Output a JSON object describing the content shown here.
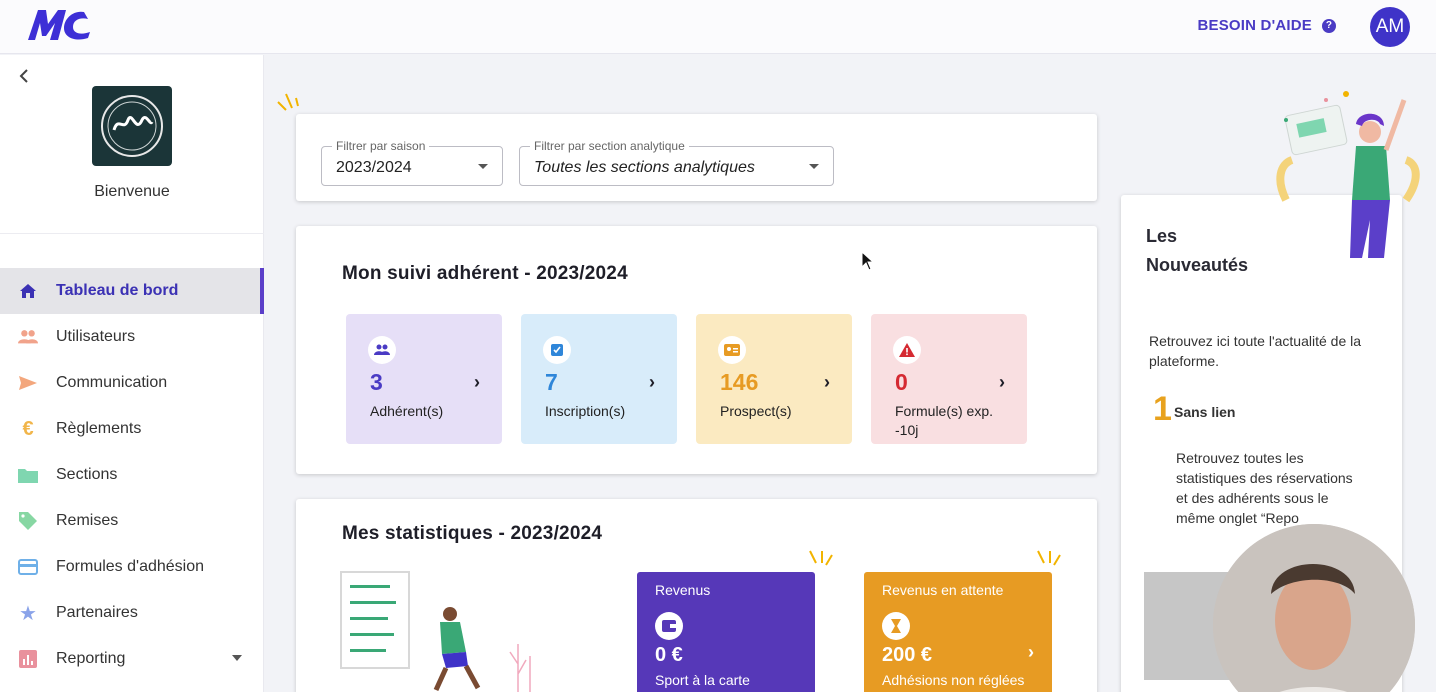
{
  "topbar": {
    "help_label": "BESOIN D'AIDE",
    "help_icon": "question-circle-icon",
    "avatar_initials": "AM",
    "brand_color": "#4a3bc4"
  },
  "sidebar": {
    "back_icon": "chevron-left-icon",
    "welcome": "Bienvenue",
    "items": [
      {
        "label": "Tableau de bord",
        "icon": "home-icon",
        "active": true
      },
      {
        "label": "Utilisateurs",
        "icon": "users-icon"
      },
      {
        "label": "Communication",
        "icon": "send-icon"
      },
      {
        "label": "Règlements",
        "icon": "euro-icon"
      },
      {
        "label": "Sections",
        "icon": "folder-icon"
      },
      {
        "label": "Remises",
        "icon": "tag-icon"
      },
      {
        "label": "Formules d'adhésion",
        "icon": "card-icon"
      },
      {
        "label": "Partenaires",
        "icon": "star-icon"
      },
      {
        "label": "Reporting",
        "icon": "bar-chart-icon",
        "has_submenu": true
      }
    ]
  },
  "filters": {
    "season": {
      "label": "Filtrer par saison",
      "value": "2023/2024"
    },
    "section": {
      "label": "Filtrer par section analytique",
      "value": "Toutes les sections analytiques"
    }
  },
  "suivi": {
    "title": "Mon suivi adhérent - 2023/2024",
    "tiles": [
      {
        "value": "3",
        "label": "Adhérent(s)",
        "icon": "group-icon",
        "bg": "#e6dff7",
        "color": "#4a3bc4"
      },
      {
        "value": "7",
        "label": "Inscription(s)",
        "icon": "clipboard-check-icon",
        "bg": "#d8ecfa",
        "color": "#2f86d9"
      },
      {
        "value": "146",
        "label": "Prospect(s)",
        "icon": "contact-card-icon",
        "bg": "#fbeac1",
        "color": "#e79b23"
      },
      {
        "value": "0",
        "label": "Formule(s) exp. -10j",
        "icon": "warning-icon",
        "bg": "#f9dfe1",
        "color": "#d52a32"
      }
    ]
  },
  "stats": {
    "title": "Mes statistiques - 2023/2024",
    "revenus": {
      "title": "Revenus",
      "amount": "0 €",
      "sub": "Sport à la carte",
      "icon": "wallet-icon",
      "bg": "#5638b8"
    },
    "attente": {
      "title": "Revenus en attente",
      "amount": "200 €",
      "sub": "Adhésions non réglées",
      "icon": "hourglass-icon",
      "bg": "#e79b23"
    }
  },
  "news": {
    "title": "Les Nouveautés",
    "intro": "Retrouvez ici toute l'actualité de la plateforme.",
    "item_number": "1",
    "item_head": "Sans lien",
    "item_body": "Retrouvez toutes les statistiques des réservations et des adhérents sous le même onglet “Repo"
  }
}
